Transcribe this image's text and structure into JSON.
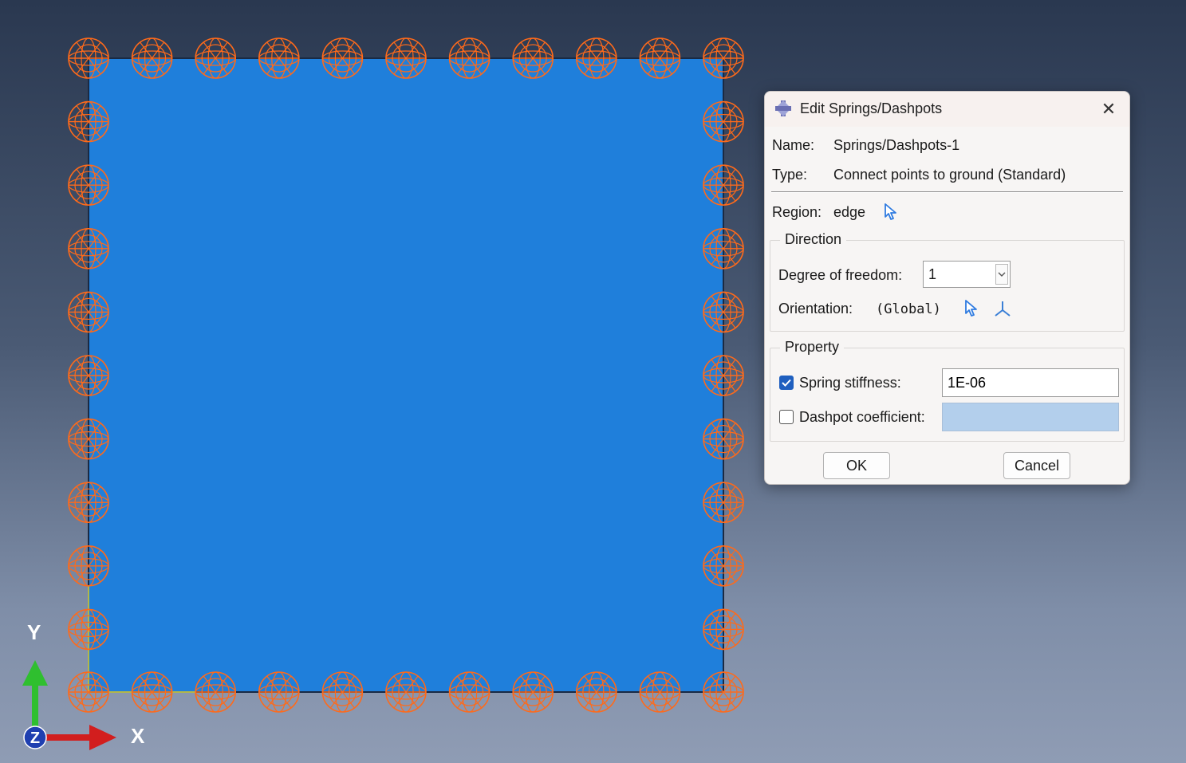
{
  "viewport": {
    "part_color": "#1f7fdb",
    "symbol_color": "#ff6a1a",
    "triad": {
      "x_label": "X",
      "y_label": "Y",
      "z_label": "Z"
    }
  },
  "dialog": {
    "title": "Edit Springs/Dashpots",
    "close_glyph": "✕",
    "name_label": "Name:",
    "name_value": "Springs/Dashpots-1",
    "type_label": "Type:",
    "type_value": "Connect points to ground (Standard)",
    "region_label": "Region:",
    "region_value": "edge",
    "direction": {
      "title": "Direction",
      "dof_label": "Degree of freedom:",
      "dof_value": "1",
      "orientation_label": "Orientation:",
      "orientation_value": "(Global)"
    },
    "property": {
      "title": "Property",
      "spring_label": "Spring stiffness:",
      "spring_checked": true,
      "spring_value": "1E-06",
      "dashpot_label": "Dashpot coefficient:",
      "dashpot_checked": false,
      "dashpot_value": ""
    },
    "ok_label": "OK",
    "cancel_label": "Cancel"
  }
}
